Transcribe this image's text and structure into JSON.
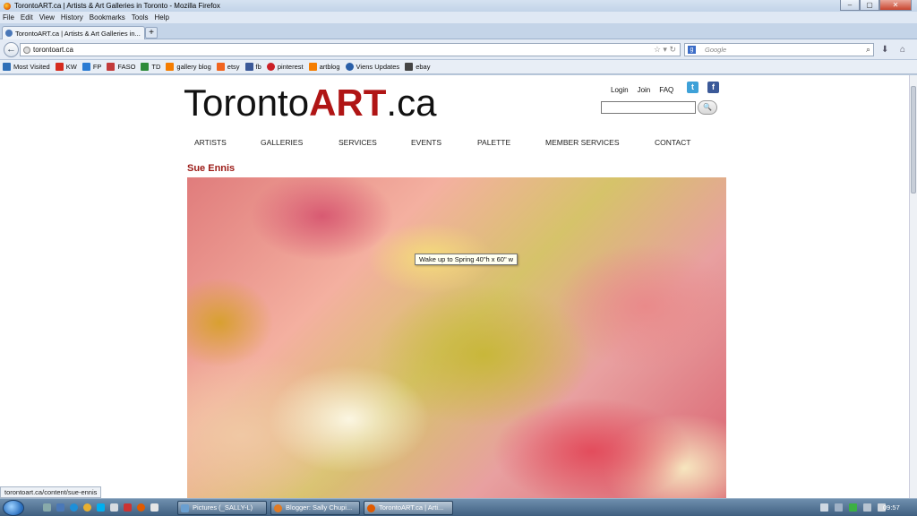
{
  "window": {
    "title": "TorontoART.ca | Artists & Art Galleries in Toronto - Mozilla Firefox",
    "min": "–",
    "max": "▢",
    "close": "✕"
  },
  "menu": [
    "File",
    "Edit",
    "View",
    "History",
    "Bookmarks",
    "Tools",
    "Help"
  ],
  "tab": {
    "title": "TorontoART.ca | Artists & Art Galleries in...",
    "new_tab": "+"
  },
  "nav": {
    "url": "torontoart.ca",
    "search_engine": "Google",
    "back": "←"
  },
  "bookmarks": [
    {
      "label": "Most Visited",
      "icon": "most-visited-icon",
      "color": "#2f6fb7"
    },
    {
      "label": "KW",
      "icon": "maple-leaf-icon",
      "color": "#d52b1e"
    },
    {
      "label": "FP",
      "icon": "fp-icon",
      "color": "#2a7bd3"
    },
    {
      "label": "FASO",
      "icon": "faso-icon",
      "color": "#c23a3a"
    },
    {
      "label": "TD",
      "icon": "td-icon",
      "color": "#2e8b3a"
    },
    {
      "label": "gallery blog",
      "icon": "blogger-icon",
      "color": "#f57d00"
    },
    {
      "label": "etsy",
      "icon": "etsy-icon",
      "color": "#f1641e"
    },
    {
      "label": "fb",
      "icon": "facebook-icon",
      "color": "#3b5998"
    },
    {
      "label": "pinterest",
      "icon": "pinterest-icon",
      "color": "#cb2027"
    },
    {
      "label": "artblog",
      "icon": "blogger-icon",
      "color": "#f57d00"
    },
    {
      "label": "Viens Updates",
      "icon": "cloud-icon",
      "color": "#2a5fa8"
    },
    {
      "label": "ebay",
      "icon": "ebay-icon",
      "color": "#444444"
    }
  ],
  "site": {
    "logo_main": "Toronto",
    "logo_art": "ART",
    "logo_suffix": ".ca",
    "top_links": [
      "Login",
      "Join",
      "FAQ"
    ],
    "twitter": "t",
    "facebook": "f",
    "search_button": "🔍",
    "nav": [
      "ARTISTS",
      "GALLERIES",
      "SERVICES",
      "EVENTS",
      "PALETTE",
      "MEMBER SERVICES",
      "CONTACT"
    ],
    "artist_name": "Sue Ennis",
    "tooltip": "Wake up to Spring  40\"h x 60\" w"
  },
  "status": {
    "url": "torontoart.ca/content/sue-ennis"
  },
  "taskbar": {
    "tasks": [
      {
        "label": "Pictures (_SALLY-L)",
        "color": "#6a9fd0"
      },
      {
        "label": "Blogger: Sally Chupi...",
        "color": "#e07b24"
      },
      {
        "label": "TorontoART.ca | Arti...",
        "color": "#e05a00"
      }
    ],
    "clock": "09:57"
  }
}
